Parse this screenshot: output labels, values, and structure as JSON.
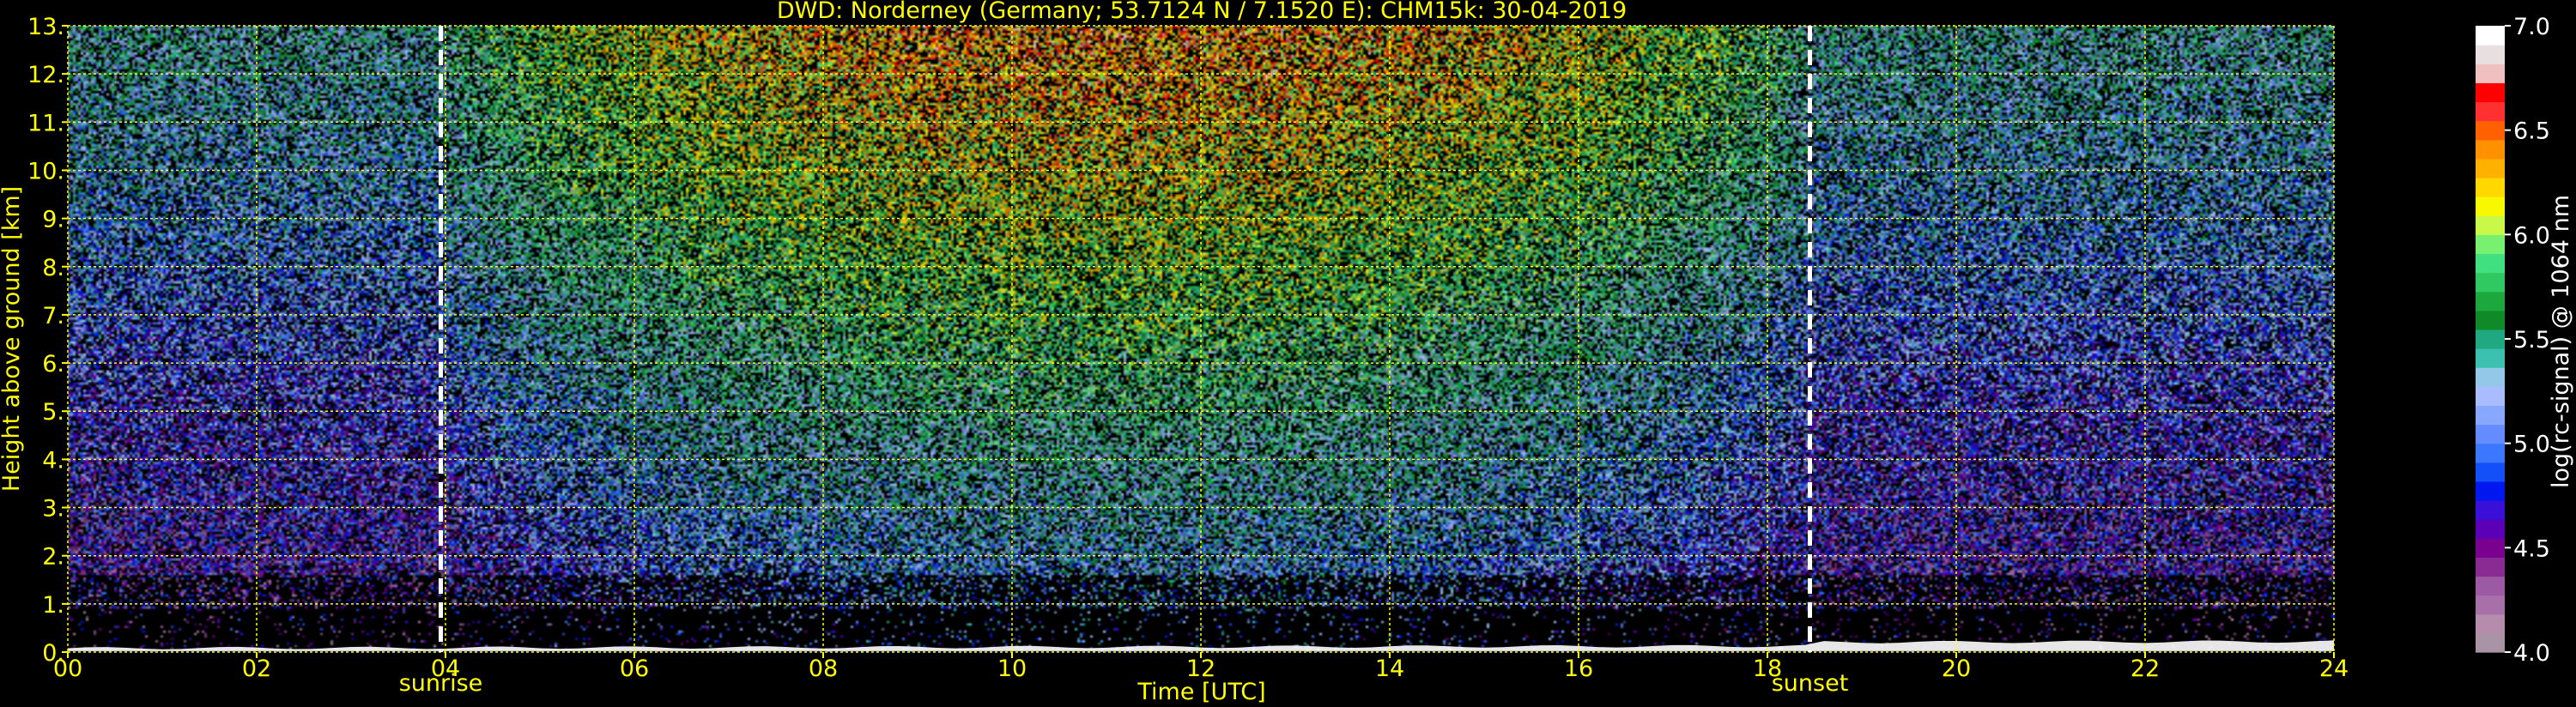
{
  "chart_data": {
    "type": "heatmap",
    "title": "DWD: Norderney (Germany; 53.7124 N / 7.1520 E):    CHM15k: 30-04-2019",
    "xlabel": "Time [UTC]",
    "ylabel": "Height above ground [km]",
    "xlim": [
      0,
      24
    ],
    "ylim": [
      0,
      13
    ],
    "x_ticks": [
      "00",
      "02",
      "04",
      "06",
      "08",
      "10",
      "12",
      "14",
      "16",
      "18",
      "20",
      "22",
      "24"
    ],
    "y_ticks": [
      "0.",
      "1.",
      "2.",
      "3.",
      "4.",
      "5.",
      "6.",
      "7.",
      "8.",
      "9.",
      "10.",
      "11.",
      "12.",
      "13."
    ],
    "grid": true,
    "markers": [
      {
        "label": "sunrise",
        "x": 3.95
      },
      {
        "label": "sunset",
        "x": 18.45
      }
    ],
    "colorbar": {
      "label": "log(rc-signal) @ 1064 nm",
      "range": [
        4.0,
        7.0
      ],
      "ticks": [
        "4.0",
        "4.5",
        "5.0",
        "5.5",
        "6.0",
        "6.5",
        "7.0"
      ]
    },
    "colors": {
      "text": "#ffff00",
      "grid": "#ffff00",
      "marker": "#ffffff",
      "background": "#000000"
    },
    "palette": [
      "#a894a4",
      "#b68cad",
      "#a870a9",
      "#9c5aa4",
      "#8a2a93",
      "#7a0090",
      "#5c00b8",
      "#3a10d8",
      "#0018f0",
      "#1450f8",
      "#3c78ff",
      "#648cff",
      "#88a8ff",
      "#a8bcff",
      "#94c8e8",
      "#3cc0b0",
      "#20a880",
      "#108a28",
      "#1ca83c",
      "#30c860",
      "#40e080",
      "#78f070",
      "#c8f848",
      "#f8f800",
      "#ffd800",
      "#ffb000",
      "#ff9000",
      "#ff6000",
      "#ff3030",
      "#ff0000",
      "#f0c0c0",
      "#e8e0e0",
      "#ffffff"
    ]
  }
}
